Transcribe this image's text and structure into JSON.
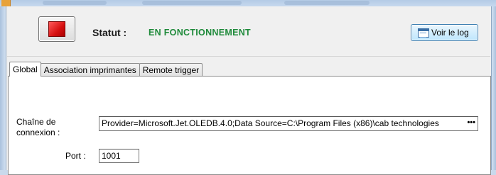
{
  "status": {
    "label": "Statut :",
    "value": "EN FONCTIONNEMENT",
    "value_color": "#1e8a3a",
    "stop_icon": "stop-square-icon",
    "stop_color": "#d60f0f"
  },
  "toolbar": {
    "view_log_label": "Voir le log",
    "view_log_icon": "log-window-icon"
  },
  "tabs": [
    {
      "label": "Global",
      "active": true
    },
    {
      "label": "Association imprimantes",
      "active": false
    },
    {
      "label": "Remote trigger",
      "active": false
    }
  ],
  "global": {
    "connection_label": "Chaîne de connexion :",
    "connection_value": "Provider=Microsoft.Jet.OLEDB.4.0;Data Source=C:\\Program Files (x86)\\cab technologies",
    "connection_more": "•••",
    "port_label": "Port :",
    "port_value": "1001"
  }
}
